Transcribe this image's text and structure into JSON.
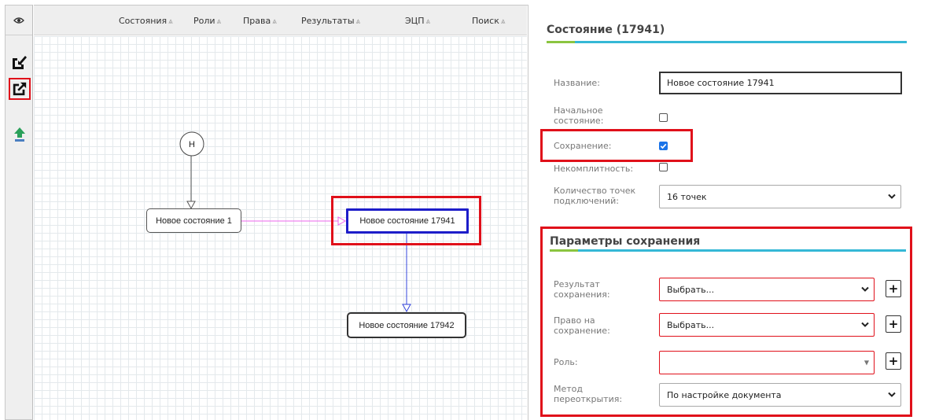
{
  "toolbar": {
    "menu": [
      {
        "label": "Состояния"
      },
      {
        "label": "Роли"
      },
      {
        "label": "Права"
      },
      {
        "label": "Результаты"
      },
      {
        "label": "ЭЦП"
      },
      {
        "label": "Поиск"
      }
    ],
    "chevron_glyph": "⩓"
  },
  "left_tools": [
    {
      "icon": "eye-icon"
    },
    {
      "icon": "import-arrow-icon"
    },
    {
      "icon": "export-arrow-icon"
    },
    {
      "icon": "upload-icon"
    }
  ],
  "diagram": {
    "start_node": "Н",
    "nodes": [
      "Новое состояние 1",
      "Новое состояние 17941",
      "Новое состояние 17942"
    ],
    "colors": {
      "selected": "#1d1dc9",
      "edge_pink": "#ee66ee",
      "edge_blue": "#3344dd",
      "highlight": "#e0101a"
    }
  },
  "panel": {
    "title": "Состояние (17941)",
    "name_label": "Название:",
    "name_value": "Новое состояние 17941",
    "initial_label": "Начальное состояние:",
    "initial_checked": false,
    "save_label": "Сохранение:",
    "save_checked": true,
    "incomplete_label": "Некомплитность:",
    "incomplete_checked": false,
    "points_label": "Количество точек подключений:",
    "points_value": "16 точек",
    "save_params": {
      "title": "Параметры сохранения",
      "result_label": "Результат сохранения:",
      "result_value": "Выбрать...",
      "right_label": "Право на сохранение:",
      "right_value": "Выбрать...",
      "role_label": "Роль:",
      "role_value": "",
      "reopen_label": "Метод переоткрытия:",
      "reopen_value": "По настройке документа"
    },
    "plus_label": "+"
  }
}
